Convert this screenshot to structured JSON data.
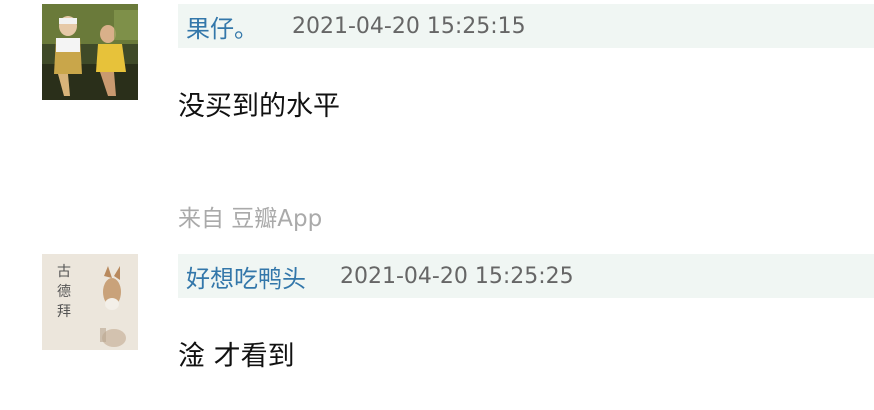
{
  "comments": [
    {
      "author": "果仔。",
      "time": "2021-04-20 15:25:15",
      "text": "没买到的水平",
      "source": "来自 豆瓣App"
    },
    {
      "author": "好想吃鸭头",
      "time": "2021-04-20 15:25:25",
      "text": "淦 才看到",
      "avatar_text": "古德拜"
    }
  ]
}
